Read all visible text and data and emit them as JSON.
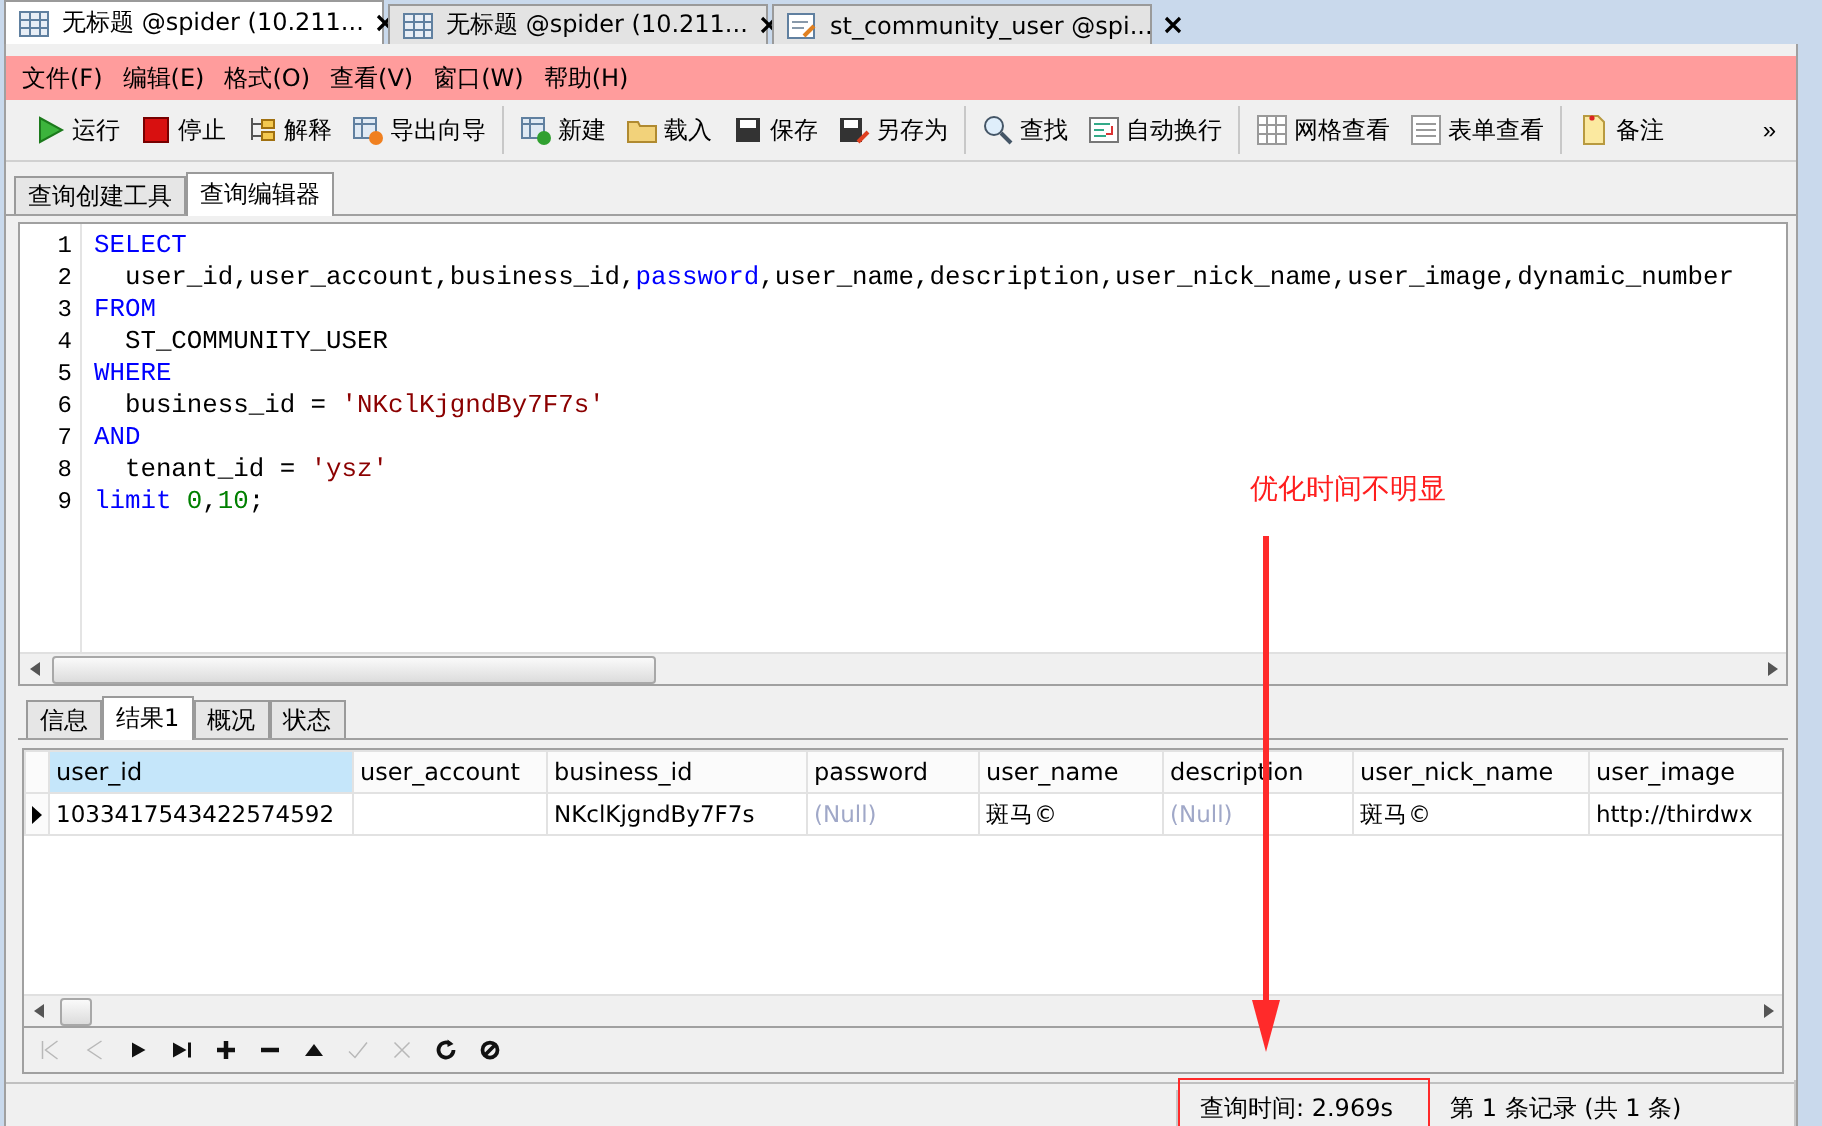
{
  "doc_tabs": [
    {
      "label": "无标题 @spider (10.211...",
      "kind": "table",
      "selected": true
    },
    {
      "label": "无标题 @spider (10.211...",
      "kind": "table",
      "selected": false
    },
    {
      "label": "st_community_user @spi...",
      "kind": "query",
      "selected": false
    }
  ],
  "menu": [
    "文件(F)",
    "编辑(E)",
    "格式(O)",
    "查看(V)",
    "窗口(W)",
    "帮助(H)"
  ],
  "toolbar": {
    "groups": [
      {
        "items": [
          {
            "label": "运行",
            "kind": "run"
          },
          {
            "label": "停止",
            "kind": "stop"
          },
          {
            "label": "解释",
            "kind": "explain"
          },
          {
            "label": "导出向导",
            "kind": "export"
          }
        ]
      },
      {
        "items": [
          {
            "label": "新建",
            "kind": "new"
          },
          {
            "label": "载入",
            "kind": "load"
          },
          {
            "label": "保存",
            "kind": "save"
          },
          {
            "label": "另存为",
            "kind": "saveas"
          }
        ]
      },
      {
        "items": [
          {
            "label": "查找",
            "kind": "find"
          },
          {
            "label": "自动换行",
            "kind": "wrap"
          }
        ]
      },
      {
        "items": [
          {
            "label": "网格查看",
            "kind": "grid"
          },
          {
            "label": "表单查看",
            "kind": "form"
          }
        ]
      },
      {
        "items": [
          {
            "label": "备注",
            "kind": "note"
          }
        ]
      }
    ],
    "overflow": "»"
  },
  "editor_tabs": [
    {
      "label": "查询创建工具",
      "selected": false
    },
    {
      "label": "查询编辑器",
      "selected": true
    }
  ],
  "editor": {
    "lines": [
      {
        "number": "1",
        "tokens": [
          {
            "text": "SELECT",
            "kind": "keyword"
          }
        ]
      },
      {
        "number": "2",
        "tokens": [
          {
            "text": "  user_id,user_account,business_id,",
            "kind": "plain"
          },
          {
            "text": "password",
            "kind": "keyword"
          },
          {
            "text": ",user_name,description,user_nick_name,user_image,dynamic_number",
            "kind": "plain"
          }
        ]
      },
      {
        "number": "3",
        "tokens": [
          {
            "text": "FROM",
            "kind": "keyword"
          }
        ]
      },
      {
        "number": "4",
        "tokens": [
          {
            "text": "  ST_COMMUNITY_USER",
            "kind": "plain"
          }
        ]
      },
      {
        "number": "5",
        "tokens": [
          {
            "text": "WHERE",
            "kind": "keyword"
          }
        ]
      },
      {
        "number": "6",
        "tokens": [
          {
            "text": "  business_id = ",
            "kind": "plain"
          },
          {
            "text": "'NKclKjgndBy7F7s'",
            "kind": "string"
          }
        ]
      },
      {
        "number": "7",
        "tokens": [
          {
            "text": "AND",
            "kind": "keyword"
          }
        ]
      },
      {
        "number": "8",
        "tokens": [
          {
            "text": "  tenant_id = ",
            "kind": "plain"
          },
          {
            "text": "'ysz'",
            "kind": "string"
          }
        ]
      },
      {
        "number": "9",
        "tokens": [
          {
            "text": "limit ",
            "kind": "keyword"
          },
          {
            "text": "0",
            "kind": "number"
          },
          {
            "text": ",",
            "kind": "plain"
          },
          {
            "text": "10",
            "kind": "number"
          },
          {
            "text": ";",
            "kind": "plain"
          }
        ]
      }
    ]
  },
  "annotation": "优化时间不明显",
  "result_tabs": [
    {
      "label": "信息",
      "selected": false
    },
    {
      "label": "结果1",
      "selected": true
    },
    {
      "label": "概况",
      "selected": false
    },
    {
      "label": "状态",
      "selected": false
    }
  ],
  "grid": {
    "columns": [
      {
        "label": "user_id",
        "selected": true
      },
      {
        "label": "user_account",
        "selected": false
      },
      {
        "label": "business_id",
        "selected": false
      },
      {
        "label": "password",
        "selected": false
      },
      {
        "label": "user_name",
        "selected": false
      },
      {
        "label": "description",
        "selected": false
      },
      {
        "label": "user_nick_name",
        "selected": false
      },
      {
        "label": "user_image",
        "selected": false
      }
    ],
    "rows": [
      {
        "selected": true,
        "cells": [
          {
            "text": "1033417543422574592",
            "kind": "value"
          },
          {
            "kind": "empty"
          },
          {
            "text": "NKclKjgndBy7F7s",
            "kind": "value"
          },
          {
            "text": "(Null)",
            "kind": "null"
          },
          {
            "text": "斑马©",
            "kind": "value"
          },
          {
            "text": "(Null)",
            "kind": "null"
          },
          {
            "text": "斑马©",
            "kind": "value"
          },
          {
            "text": "http://thirdwx",
            "kind": "value"
          }
        ]
      }
    ]
  },
  "nav_buttons": [
    {
      "kind": "first",
      "disabled": true
    },
    {
      "kind": "prev",
      "disabled": true
    },
    {
      "kind": "next",
      "disabled": false
    },
    {
      "kind": "last",
      "disabled": false
    },
    {
      "kind": "add",
      "disabled": false
    },
    {
      "kind": "remove",
      "disabled": false
    },
    {
      "kind": "up",
      "disabled": false
    },
    {
      "kind": "apply",
      "disabled": true
    },
    {
      "kind": "discard",
      "disabled": true
    },
    {
      "kind": "refresh",
      "disabled": false
    },
    {
      "kind": "cancel",
      "disabled": false
    }
  ],
  "status_bar": [
    {
      "text": "查询时间: 2.969s",
      "highlighted": true
    },
    {
      "text": "第 1 条记录 (共 1 条)",
      "highlighted": false
    }
  ]
}
